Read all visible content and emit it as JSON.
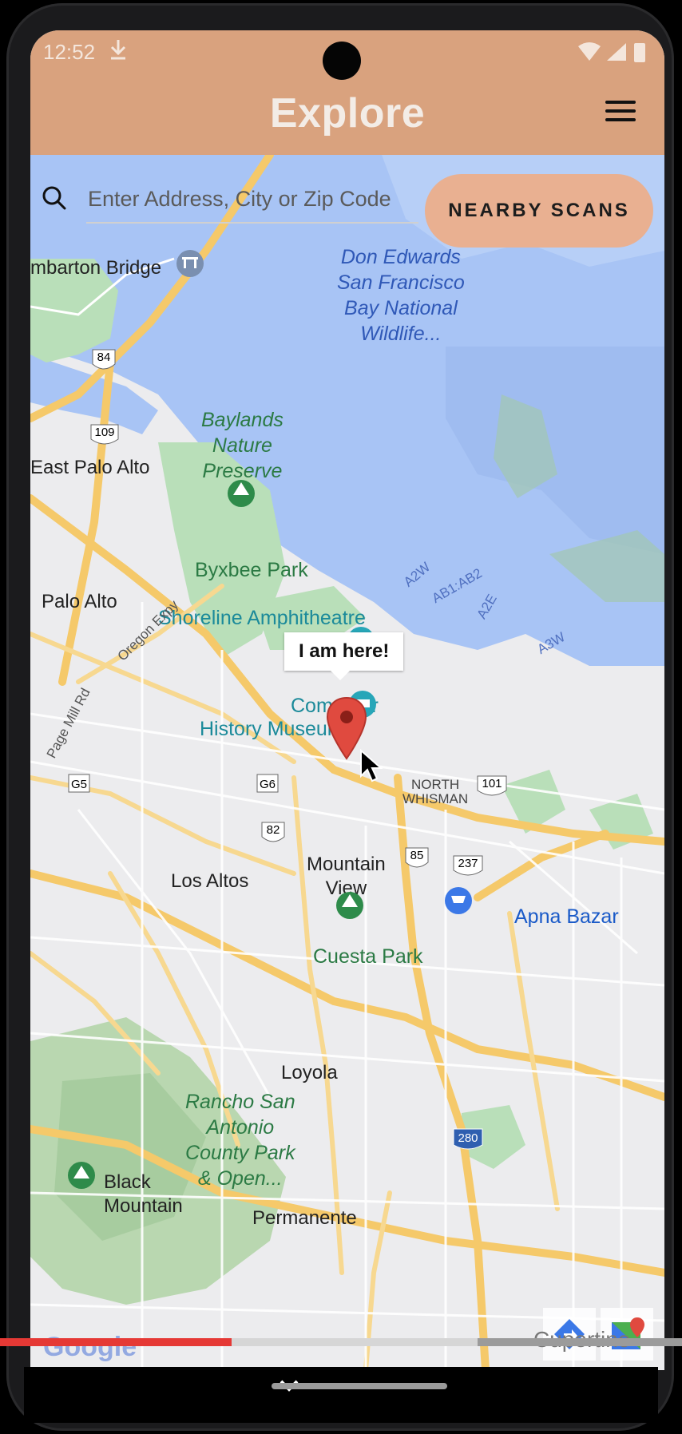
{
  "status_bar": {
    "time": "12:52"
  },
  "app_bar": {
    "title": "Explore"
  },
  "search": {
    "placeholder": "Enter Address, City or Zip Code"
  },
  "nearby_button": {
    "label": "NEARBY SCANS"
  },
  "map": {
    "callout": "I am here!",
    "labels": {
      "dumbarton": "mbarton Bridge",
      "don_edwards_1": "Don Edwards",
      "don_edwards_2": "San Francisco",
      "don_edwards_3": "Bay National",
      "don_edwards_4": "Wildlife...",
      "baylands_1": "Baylands",
      "baylands_2": "Nature",
      "baylands_3": "Preserve",
      "east_palo_alto": "East Palo Alto",
      "palo_alto": "Palo Alto",
      "byxbee": "Byxbee Park",
      "shoreline": "Shoreline Amphitheatre",
      "computer_1": "Computer",
      "computer_2": "History Museum",
      "oregon": "Oregon Expy",
      "page_mill": "Page Mill Rd",
      "north_whisman_1": "NORTH",
      "north_whisman_2": "WHISMAN",
      "mountain_view_1": "Mountain",
      "mountain_view_2": "View",
      "los_altos": "Los Altos",
      "apna": "Apna Bazar",
      "cuesta": "Cuesta Park",
      "loyola": "Loyola",
      "rancho_1": "Rancho San",
      "rancho_2": "Antonio",
      "rancho_3": "County Park",
      "rancho_4": "& Open...",
      "black_mountain_1": "Black",
      "black_mountain_2": "Mountain",
      "permanente": "Permanente",
      "cupertino": "Cupertino",
      "google": "Google"
    },
    "shields": {
      "r84": "84",
      "r109": "109",
      "g5": "G5",
      "g6": "G6",
      "r82": "82",
      "r85": "85",
      "r101": "101",
      "r237": "237",
      "r280": "280"
    },
    "small_labels": {
      "a2w": "A2W",
      "ab1ab2": "AB1:AB2",
      "a2e": "A2E",
      "a3w": "A3W"
    }
  },
  "video_progress": {
    "played_fraction": 0.34,
    "buffered_fraction": 0.7
  },
  "colors": {
    "header": "#d9a27e",
    "button": "#e9b091",
    "water": "#a8c4f5",
    "land": "#ececee",
    "park": "#b9dfb9",
    "road": "#f5c96a",
    "progress": "#e53935"
  }
}
